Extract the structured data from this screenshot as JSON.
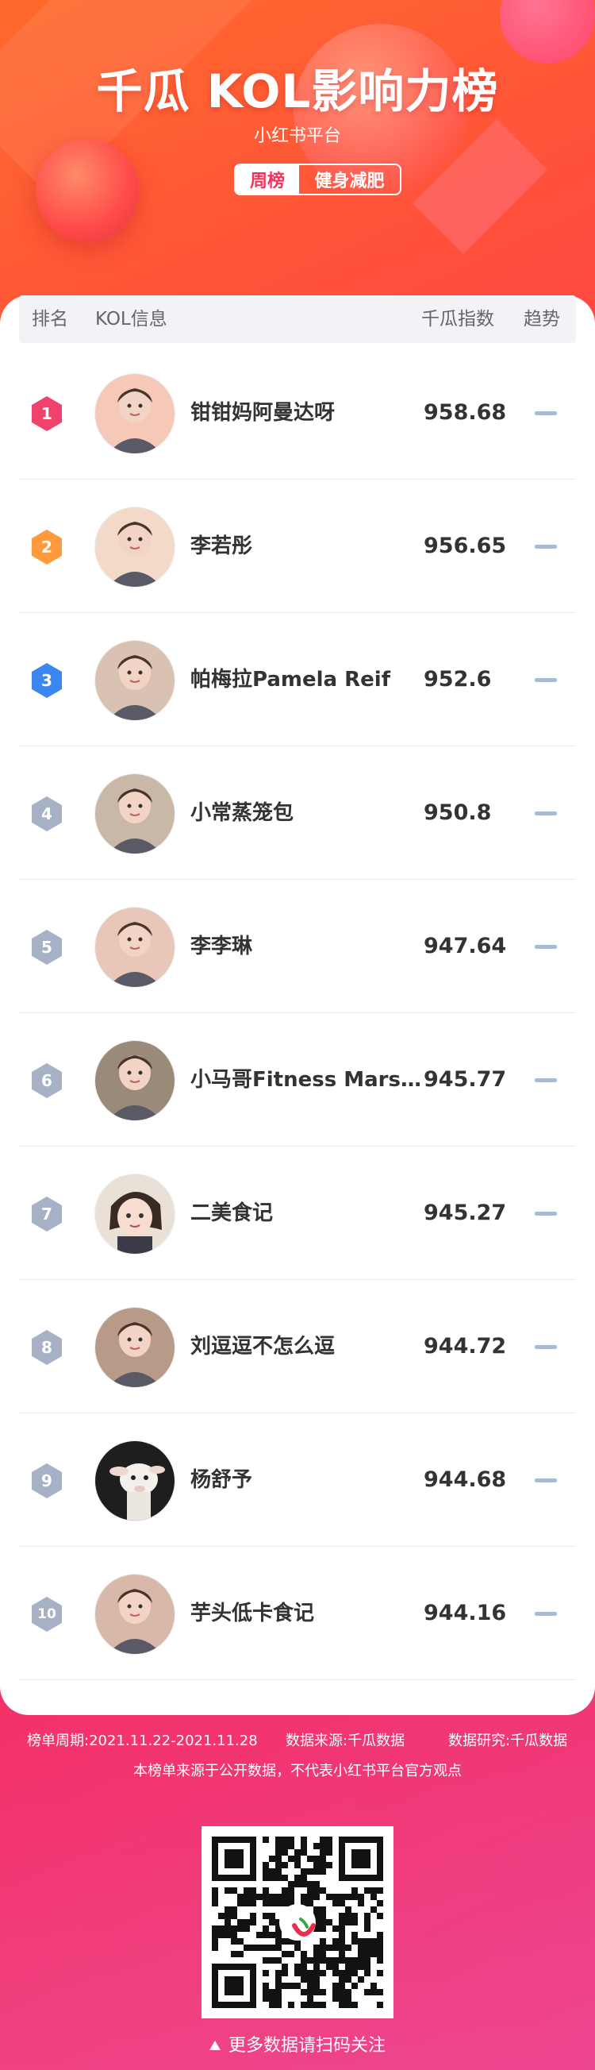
{
  "header": {
    "title": "千瓜 KOL影响力榜",
    "platform": "小红书平台",
    "tag_period": "周榜",
    "tag_category": "健身减肥"
  },
  "table": {
    "col_rank": "排名",
    "col_kol": "KOL信息",
    "col_index": "千瓜指数",
    "col_trend": "趋势"
  },
  "colors": {
    "rank1": "#f0426c",
    "rank2": "#ff9a3c",
    "rank3": "#3c86f0",
    "rank_other": "#a7b1c6",
    "trend": "#a8bbd0"
  },
  "rows": [
    {
      "rank": "1",
      "name": "钳钳妈阿曼达呀",
      "score": "958.68",
      "trend": "flat",
      "avatar": "avatar-photo"
    },
    {
      "rank": "2",
      "name": "李若彤",
      "score": "956.65",
      "trend": "flat",
      "avatar": "avatar-photo"
    },
    {
      "rank": "3",
      "name": "帕梅拉Pamela Reif",
      "score": "952.6",
      "trend": "flat",
      "avatar": "avatar-photo"
    },
    {
      "rank": "4",
      "name": "小常蒸笼包",
      "score": "950.8",
      "trend": "flat",
      "avatar": "avatar-photo"
    },
    {
      "rank": "5",
      "name": "李李琳",
      "score": "947.64",
      "trend": "flat",
      "avatar": "avatar-photo"
    },
    {
      "rank": "6",
      "name": "小马哥Fitness Marsh...",
      "score": "945.77",
      "trend": "flat",
      "avatar": "avatar-photo"
    },
    {
      "rank": "7",
      "name": "二美食记",
      "score": "945.27",
      "trend": "flat",
      "avatar": "avatar-illustration"
    },
    {
      "rank": "8",
      "name": "刘逗逗不怎么逗",
      "score": "944.72",
      "trend": "flat",
      "avatar": "avatar-photo"
    },
    {
      "rank": "9",
      "name": "杨舒予",
      "score": "944.68",
      "trend": "flat",
      "avatar": "avatar-lamb"
    },
    {
      "rank": "10",
      "name": "芋头低卡食记",
      "score": "944.16",
      "trend": "flat",
      "avatar": "avatar-photo"
    }
  ],
  "footer": {
    "period": "榜单周期:2021.11.22-2021.11.28",
    "source": "数据来源:千瓜数据",
    "research": "数据研究:千瓜数据",
    "disclaimer": "本榜单来源于公开数据，不代表小红书平台官方观点",
    "scan_tip": "更多数据请扫码关注"
  }
}
